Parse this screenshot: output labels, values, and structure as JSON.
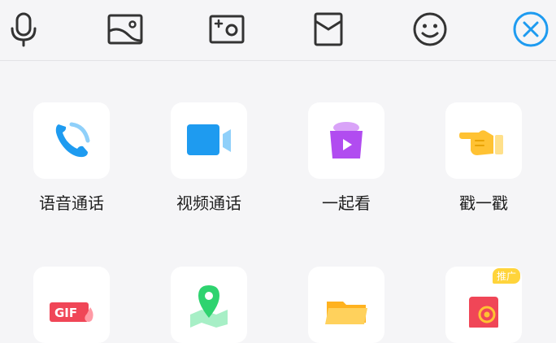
{
  "toolbar": {
    "icons": [
      "microphone-icon",
      "image-icon",
      "camera-icon",
      "red-packet-icon",
      "emoji-icon",
      "close-icon"
    ]
  },
  "features": [
    {
      "label": "语音通话",
      "icon": "phone-icon"
    },
    {
      "label": "视频通话",
      "icon": "video-camera-icon"
    },
    {
      "label": "一起看",
      "icon": "watch-together-icon"
    },
    {
      "label": "戳一戳",
      "icon": "poke-hand-icon"
    },
    {
      "label": "",
      "icon": "gif-icon",
      "gif_text": "GIF"
    },
    {
      "label": "",
      "icon": "location-icon"
    },
    {
      "label": "",
      "icon": "folder-icon"
    },
    {
      "label": "",
      "icon": "promo-red-packet-icon",
      "badge": "推广"
    }
  ],
  "colors": {
    "accent_blue": "#1e9bf0",
    "purple": "#b14cf0",
    "yellow": "#ffc233",
    "red": "#f04657",
    "green": "#2ed36f"
  }
}
